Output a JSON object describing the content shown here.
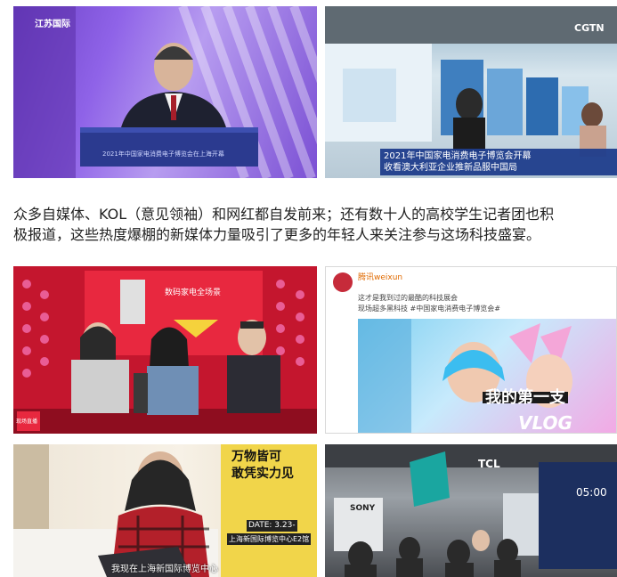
{
  "photos": {
    "speech": {
      "logo": "江苏国际",
      "screen_caption": "2021年中国家电消费电子博览会在上海开幕"
    },
    "expo_news": {
      "channel": "CGTN",
      "caption_line1": "2021年中国家电消费电子博览会开幕",
      "caption_line2": "收看澳大利亚企业推新品服中国局"
    },
    "livestream": {
      "backdrop_text": "数码家电全场景",
      "corner_label": "现场直播"
    },
    "weibo_post": {
      "username": "腾讯weixun",
      "post_line1": "这才是我到过的最酷的科技展会",
      "post_line2": "现场超多黑科技 #中国家电消费电子博览会#",
      "overlay_line1": "我的第一支",
      "overlay_line2": "VLOG"
    },
    "vlogger": {
      "headline_line1": "万物皆可",
      "headline_line2": "敢凭实力见",
      "info_line1": "DATE: 3.23-",
      "info_line2": "上海新国际博览中心E2馆",
      "subtitle": "我现在上海新国际博览中心"
    },
    "booth": {
      "brand1": "TCL",
      "brand2": "SONY",
      "screen_number": "05:00"
    }
  },
  "article": {
    "line1": "众多自媒体、KOL（意见领袖）和网红都自发前来；还有数十人的高校学生记者团也积",
    "line2": "极报道，这些热度爆棚的新媒体力量吸引了更多的年轻人来关注参与这场科技盛宴。"
  }
}
